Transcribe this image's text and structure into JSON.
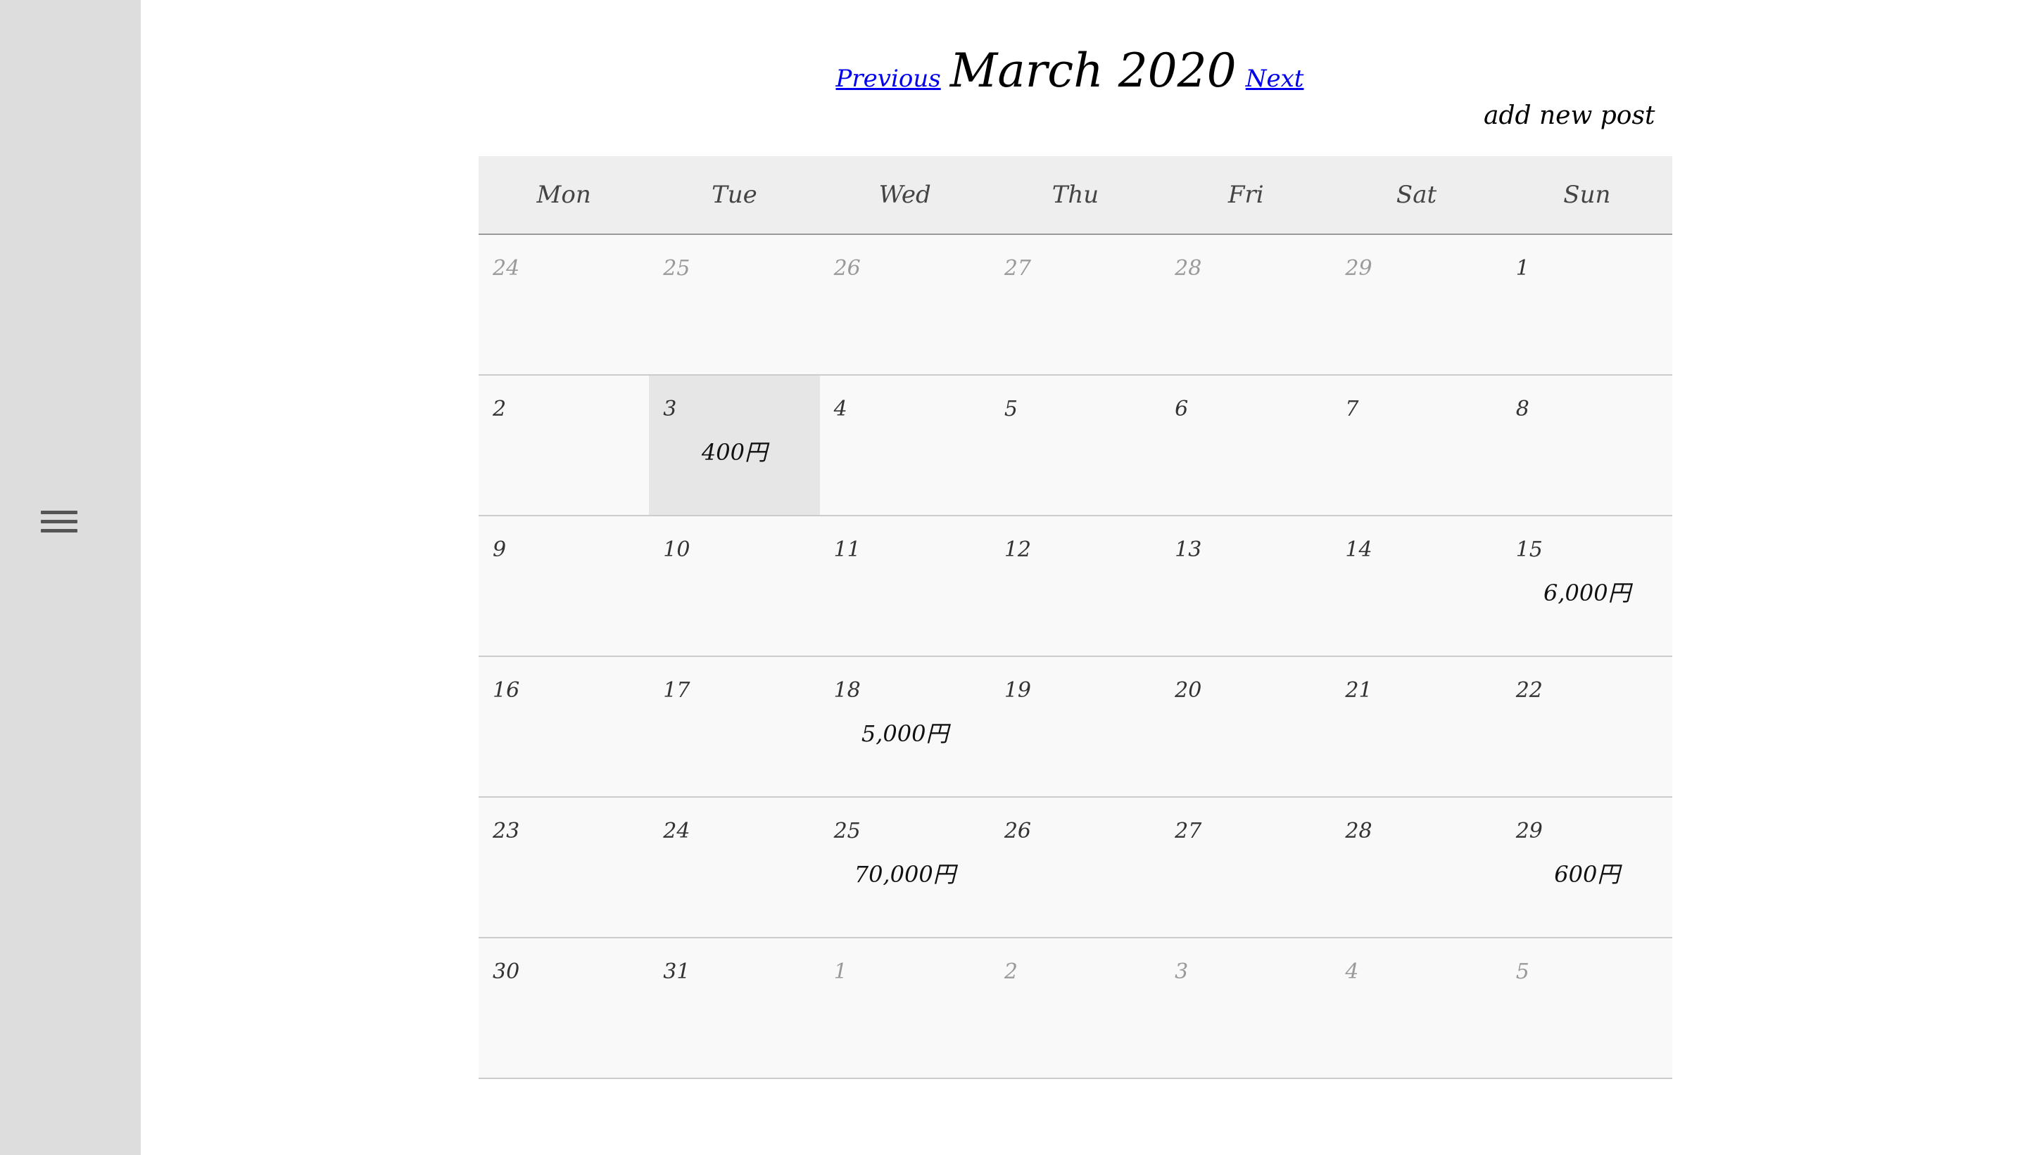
{
  "nav": {
    "previous_label": "Previous",
    "title": "March 2020",
    "next_label": "Next",
    "add_post_label": "add new post"
  },
  "calendar": {
    "weekdays": [
      "Mon",
      "Tue",
      "Wed",
      "Thu",
      "Fri",
      "Sat",
      "Sun"
    ],
    "weeks": [
      [
        {
          "day": "24",
          "other": true
        },
        {
          "day": "25",
          "other": true
        },
        {
          "day": "26",
          "other": true
        },
        {
          "day": "27",
          "other": true
        },
        {
          "day": "28",
          "other": true
        },
        {
          "day": "29",
          "other": true
        },
        {
          "day": "1"
        }
      ],
      [
        {
          "day": "2"
        },
        {
          "day": "3",
          "amount": "400円",
          "selected": true
        },
        {
          "day": "4"
        },
        {
          "day": "5"
        },
        {
          "day": "6"
        },
        {
          "day": "7"
        },
        {
          "day": "8"
        }
      ],
      [
        {
          "day": "9"
        },
        {
          "day": "10"
        },
        {
          "day": "11"
        },
        {
          "day": "12"
        },
        {
          "day": "13"
        },
        {
          "day": "14"
        },
        {
          "day": "15",
          "amount": "6,000円"
        }
      ],
      [
        {
          "day": "16"
        },
        {
          "day": "17"
        },
        {
          "day": "18",
          "amount": "5,000円"
        },
        {
          "day": "19"
        },
        {
          "day": "20"
        },
        {
          "day": "21"
        },
        {
          "day": "22"
        }
      ],
      [
        {
          "day": "23"
        },
        {
          "day": "24"
        },
        {
          "day": "25",
          "amount": "70,000円"
        },
        {
          "day": "26"
        },
        {
          "day": "27"
        },
        {
          "day": "28"
        },
        {
          "day": "29",
          "amount": "600円"
        }
      ],
      [
        {
          "day": "30"
        },
        {
          "day": "31"
        },
        {
          "day": "1",
          "other": true
        },
        {
          "day": "2",
          "other": true
        },
        {
          "day": "3",
          "other": true
        },
        {
          "day": "4",
          "other": true
        },
        {
          "day": "5",
          "other": true
        }
      ]
    ]
  },
  "colors": {
    "sidebar": "#dddddd",
    "link": "#0000ee",
    "header_row": "#eeeeee",
    "selected_day": "#e6e6e6"
  },
  "icons": {
    "menu": "hamburger-menu-icon"
  }
}
